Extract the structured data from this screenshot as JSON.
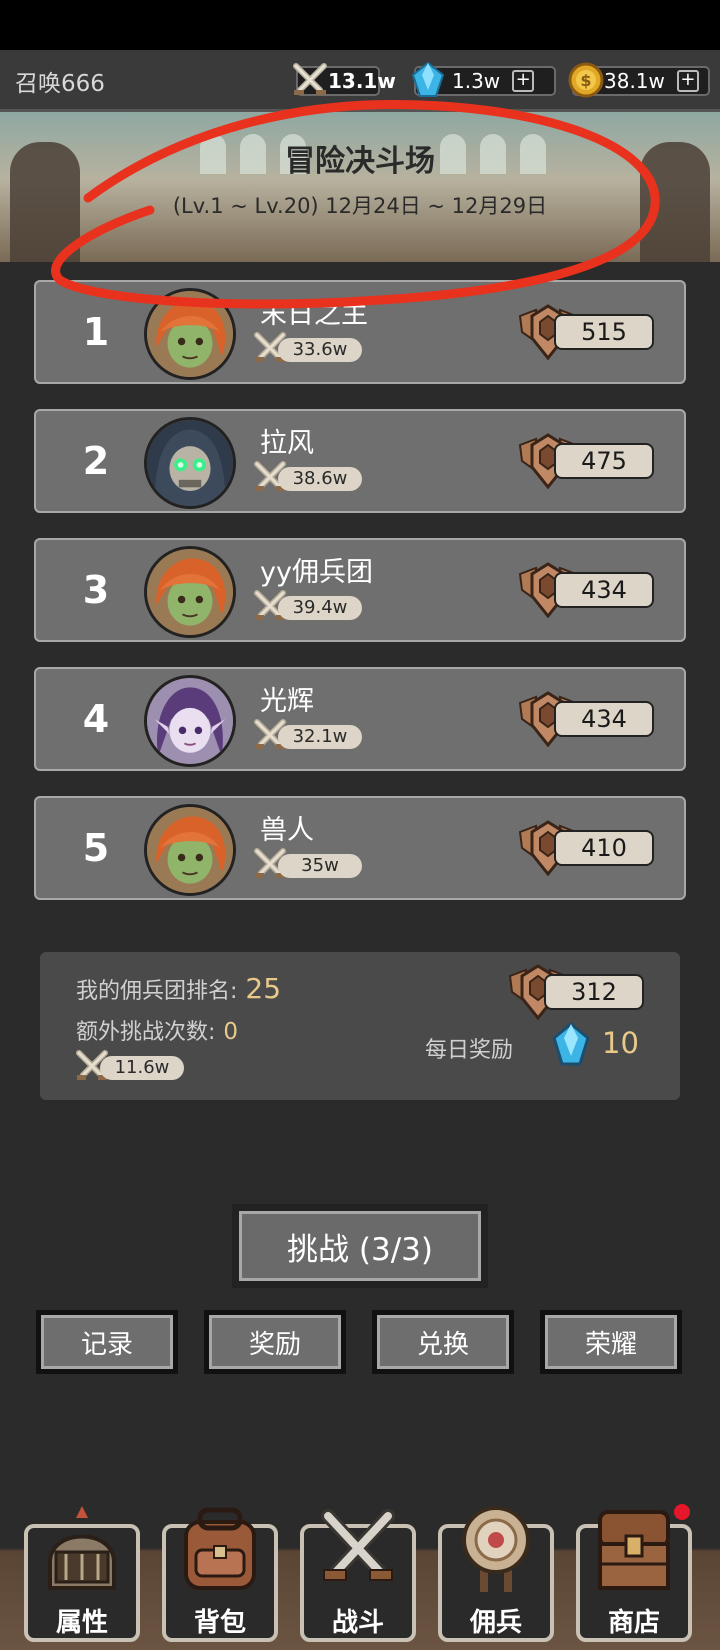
{
  "header": {
    "player_name": "召唤666",
    "power": "13.1w",
    "gems": "1.3w",
    "coins": "38.1w",
    "plus": "+"
  },
  "banner": {
    "title": "冒险决斗场",
    "subtitle": "(Lv.1 ~ Lv.20) 12月24日 ~ 12月29日"
  },
  "rankings": [
    {
      "rank": "1",
      "name": "末日之主",
      "power": "33.6w",
      "score": "515",
      "avatar": "orange-hair-goblin"
    },
    {
      "rank": "2",
      "name": "拉风",
      "power": "38.6w",
      "score": "475",
      "avatar": "hooded-skull"
    },
    {
      "rank": "3",
      "name": "yy佣兵团",
      "power": "39.4w",
      "score": "434",
      "avatar": "orange-hair-goblin"
    },
    {
      "rank": "4",
      "name": "光辉",
      "power": "32.1w",
      "score": "434",
      "avatar": "purple-hair-elf"
    },
    {
      "rank": "5",
      "name": "兽人",
      "power": "35w",
      "score": "410",
      "avatar": "orange-hair-goblin"
    }
  ],
  "my_status": {
    "rank_label": "我的佣兵团排名:",
    "rank_value": "25",
    "extra_label": "额外挑战次数:",
    "extra_value": "0",
    "power": "11.6w",
    "score": "312",
    "daily_label": "每日奖励",
    "daily_value": "10"
  },
  "actions": {
    "challenge": "挑战 (3/3)",
    "record": "记录",
    "reward": "奖励",
    "exchange": "兑换",
    "honor": "荣耀"
  },
  "nav": [
    {
      "label": "属性",
      "icon": "helmet-icon",
      "badge": false
    },
    {
      "label": "背包",
      "icon": "backpack-icon",
      "badge": false
    },
    {
      "label": "战斗",
      "icon": "crossed-swords-icon",
      "badge": false
    },
    {
      "label": "佣兵",
      "icon": "target-shield-icon",
      "badge": false
    },
    {
      "label": "商店",
      "icon": "chest-icon",
      "badge": true
    }
  ],
  "colors": {
    "accent_gold": "#e8c98a",
    "annotation_red": "#e8321e",
    "notify_red": "#e4182a"
  }
}
